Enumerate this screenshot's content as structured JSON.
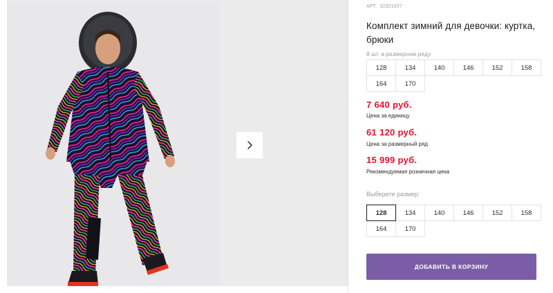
{
  "product": {
    "article_label": "АРТ.",
    "article_number": "32321027",
    "title": "Комплект зимний для девочки: куртка, брюки",
    "pack_info": "8 шт. в размерном ряду",
    "pack_sizes": [
      "128",
      "134",
      "140",
      "146",
      "152",
      "158",
      "164",
      "170"
    ]
  },
  "prices": {
    "unit_price": "7 640 руб.",
    "unit_price_label": "Цена за единицу",
    "pack_price": "61 120 руб.",
    "pack_price_label": "Цена за размерный ряд",
    "retail_price": "15 999 руб.",
    "retail_price_label": "Рекомендуемая розничная цена"
  },
  "size_selector": {
    "label": "Выберите размер:",
    "options": [
      "128",
      "134",
      "140",
      "146",
      "152",
      "158",
      "164",
      "170"
    ],
    "selected": "128"
  },
  "actions": {
    "add_to_cart": "Добавить в корзину"
  },
  "colors": {
    "price_red": "#e2122c",
    "button_purple": "#7a5da6",
    "gallery_bg": "#ebebec"
  },
  "icons": {
    "next_arrow": "chevron-right-icon"
  }
}
